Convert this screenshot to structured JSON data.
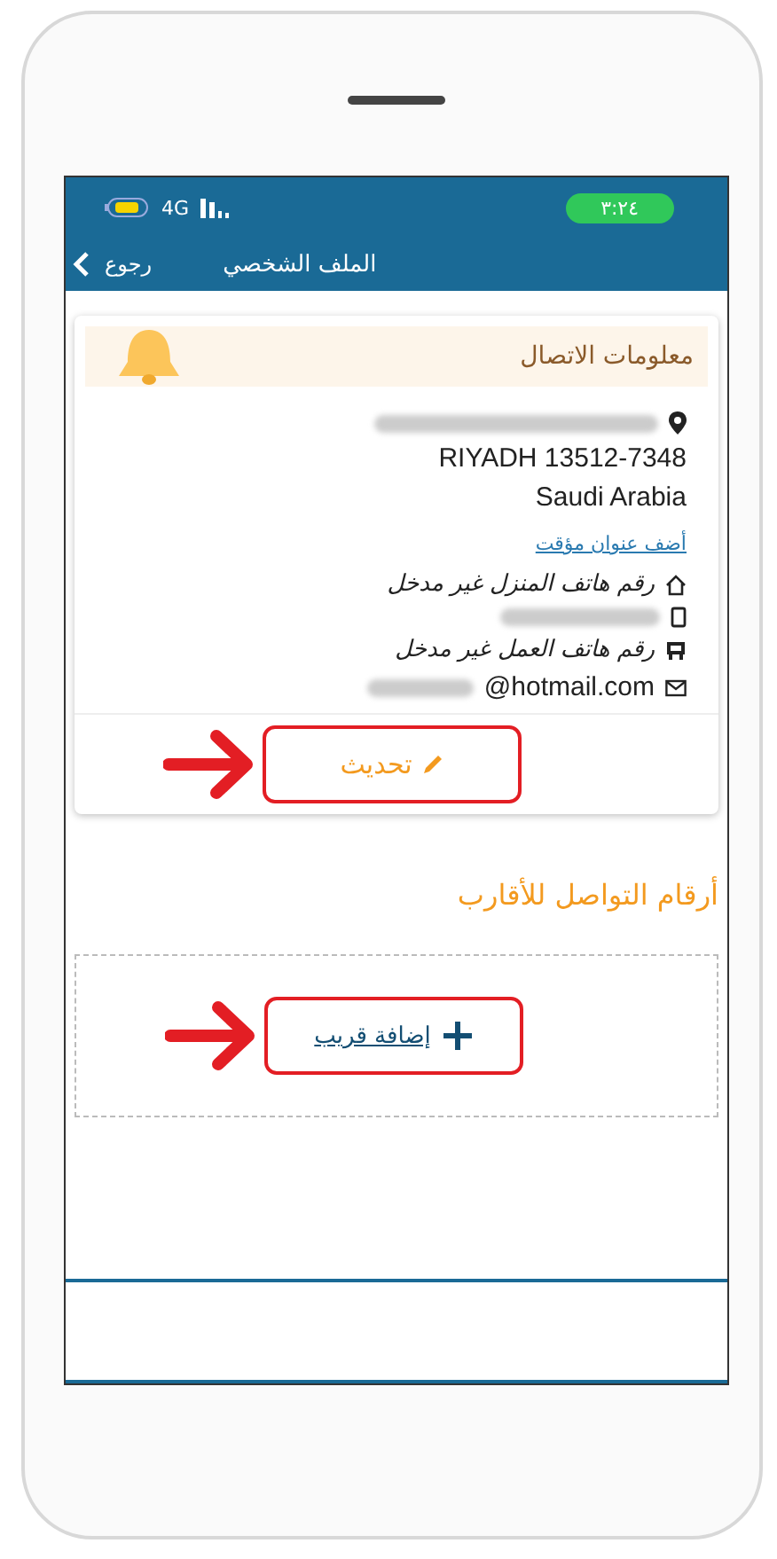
{
  "status_bar": {
    "network": "4G",
    "time": "٣:٢٤"
  },
  "nav": {
    "back": "رجوع",
    "title": "الملف الشخصي"
  },
  "contact_card": {
    "title": "معلومات الاتصال",
    "address_lines": [
      "RIYADH 13512-7348",
      "Saudi Arabia"
    ],
    "temp_address_link": "أضف عنوان مؤقت",
    "home_phone": "رقم هاتف المنزل غير مدخل",
    "work_phone": "رقم هاتف العمل غير مدخل",
    "email_domain": "@hotmail.com",
    "update_button": "تحديث"
  },
  "relatives": {
    "title": "أرقام التواصل للأقارب",
    "add_button": "إضافة قريب"
  }
}
